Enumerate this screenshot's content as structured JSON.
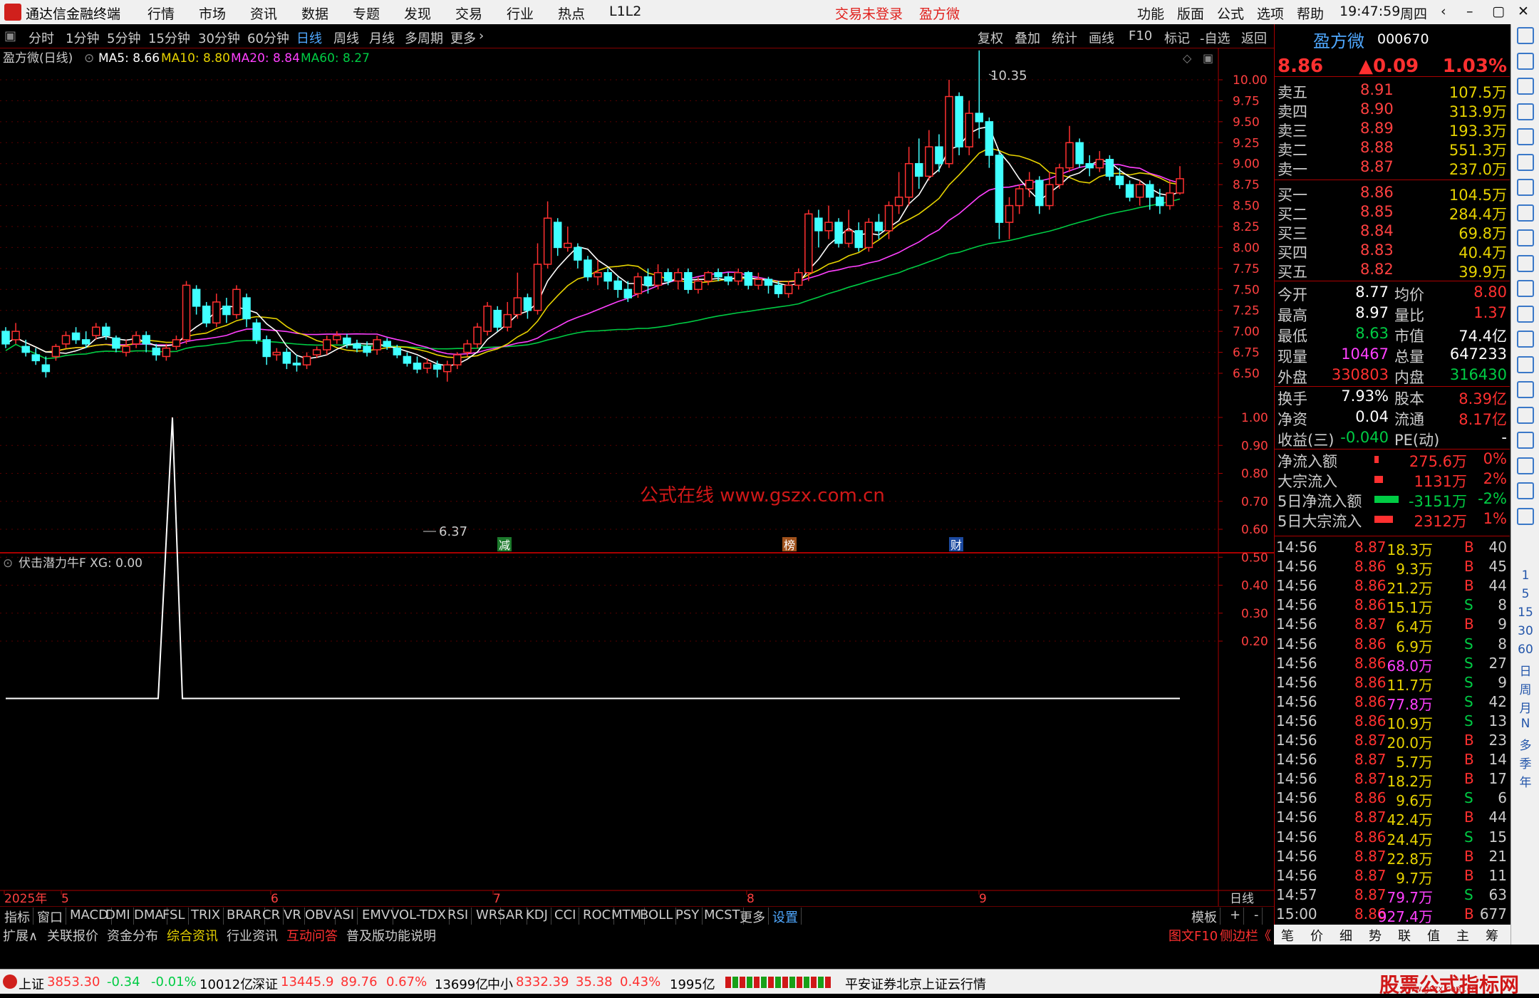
{
  "app": {
    "title": "通达信金融终端",
    "menus": [
      "行情",
      "市场",
      "资讯",
      "数据",
      "专题",
      "发现",
      "交易",
      "行业",
      "热点",
      "L1L2"
    ],
    "status_left": "交易未登录",
    "stock_name_title": "盈方微",
    "right_menus": [
      "功能",
      "版面",
      "公式",
      "选项",
      "帮助"
    ],
    "time": "19:47:59",
    "weekday": "周四"
  },
  "toolbar": {
    "periods": [
      "分时",
      "1分钟",
      "5分钟",
      "15分钟",
      "30分钟",
      "60分钟",
      "日线",
      "周线",
      "月线",
      "多周期",
      "更多"
    ],
    "active": "日线",
    "right": [
      "复权",
      "叠加",
      "统计",
      "画线",
      "F10",
      "标记",
      "-自选",
      "返回"
    ]
  },
  "chart": {
    "header": {
      "name": "盈方微(日线)",
      "ma5": "MA5: 8.66",
      "ma10": "MA10: 8.80",
      "ma20": "MA20: 8.84",
      "ma60": "MA60: 8.27"
    },
    "yticks": [
      "10.00",
      "9.75",
      "9.50",
      "9.25",
      "9.00",
      "8.75",
      "8.50",
      "8.25",
      "8.00",
      "7.75",
      "7.50",
      "7.25",
      "7.00",
      "6.75",
      "6.50"
    ],
    "high_label": "10.35",
    "low_label": "6.37",
    "watermark": "公式在线  www.gszx.com.cn",
    "events": [
      "减",
      "榜",
      "财"
    ]
  },
  "indicator": {
    "header": "伏击潜力牛F  XG: 0.00",
    "yticks": [
      "1.00",
      "0.90",
      "0.80",
      "0.70",
      "0.60",
      "0.50",
      "0.40",
      "0.30",
      "0.20"
    ]
  },
  "xaxis": {
    "labels": [
      "2025年",
      "5",
      "6",
      "7",
      "8",
      "9"
    ],
    "period": "日线"
  },
  "chart_data": {
    "type": "candlestick",
    "title": "盈方微(日线)",
    "ylim": [
      6.3,
      10.4
    ],
    "ma_lines": [
      "MA5",
      "MA10",
      "MA20",
      "MA60"
    ],
    "indicator_series": {
      "name": "XG",
      "ylim": [
        0,
        1.0
      ],
      "spike_value": 1.0,
      "current": 0.0
    }
  },
  "quote": {
    "name": "盈方微",
    "code": "000670",
    "price": "8.86",
    "change": "▲0.09",
    "pct": "1.03%",
    "asks": [
      {
        "l": "卖五",
        "p": "8.91",
        "v": "107.5万"
      },
      {
        "l": "卖四",
        "p": "8.90",
        "v": "313.9万"
      },
      {
        "l": "卖三",
        "p": "8.89",
        "v": "193.3万"
      },
      {
        "l": "卖二",
        "p": "8.88",
        "v": "551.3万"
      },
      {
        "l": "卖一",
        "p": "8.87",
        "v": "237.0万"
      }
    ],
    "bids": [
      {
        "l": "买一",
        "p": "8.86",
        "v": "104.5万"
      },
      {
        "l": "买二",
        "p": "8.85",
        "v": "284.4万"
      },
      {
        "l": "买三",
        "p": "8.84",
        "v": "69.8万"
      },
      {
        "l": "买四",
        "p": "8.83",
        "v": "40.4万"
      },
      {
        "l": "买五",
        "p": "8.82",
        "v": "39.9万"
      }
    ],
    "stats": [
      {
        "l1": "今开",
        "v1": "8.77",
        "l2": "均价",
        "v2": "8.80"
      },
      {
        "l1": "最高",
        "v1": "8.97",
        "l2": "量比",
        "v2": "1.37"
      },
      {
        "l1": "最低",
        "v1": "8.63",
        "l2": "市值",
        "v2": "74.4亿"
      },
      {
        "l1": "现量",
        "v1": "10467",
        "l2": "总量",
        "v2": "647233"
      },
      {
        "l1": "外盘",
        "v1": "330803",
        "l2": "内盘",
        "v2": "316430"
      }
    ],
    "stats2": [
      {
        "l1": "换手",
        "v1": "7.93%",
        "l2": "股本",
        "v2": "8.39亿"
      },
      {
        "l1": "净资",
        "v1": "0.04",
        "l2": "流通",
        "v2": "8.17亿"
      },
      {
        "l1": "收益(三)",
        "v1": "-0.040",
        "l2": "PE(动)",
        "v2": "-"
      }
    ],
    "flows": [
      {
        "l": "净流入额",
        "v": "275.6万",
        "p": "0%"
      },
      {
        "l": "大宗流入",
        "v": "1131万",
        "p": "2%"
      },
      {
        "l": "5日净流入额",
        "v": "-3151万",
        "p": "-2%"
      },
      {
        "l": "5日大宗流入",
        "v": "2312万",
        "p": "1%"
      }
    ],
    "ticks": [
      {
        "t": "14:56",
        "p": "8.87",
        "v": "18.3万",
        "s": "B",
        "n": "40"
      },
      {
        "t": "14:56",
        "p": "8.86",
        "v": "9.3万",
        "s": "B",
        "n": "45"
      },
      {
        "t": "14:56",
        "p": "8.86",
        "v": "21.2万",
        "s": "B",
        "n": "44"
      },
      {
        "t": "14:56",
        "p": "8.86",
        "v": "15.1万",
        "s": "S",
        "n": "8"
      },
      {
        "t": "14:56",
        "p": "8.87",
        "v": "6.4万",
        "s": "B",
        "n": "9"
      },
      {
        "t": "14:56",
        "p": "8.86",
        "v": "6.9万",
        "s": "S",
        "n": "8"
      },
      {
        "t": "14:56",
        "p": "8.86",
        "v": "68.0万",
        "s": "S",
        "n": "27"
      },
      {
        "t": "14:56",
        "p": "8.86",
        "v": "11.7万",
        "s": "S",
        "n": "9"
      },
      {
        "t": "14:56",
        "p": "8.86",
        "v": "77.8万",
        "s": "S",
        "n": "42"
      },
      {
        "t": "14:56",
        "p": "8.86",
        "v": "10.9万",
        "s": "S",
        "n": "13"
      },
      {
        "t": "14:56",
        "p": "8.87",
        "v": "20.0万",
        "s": "B",
        "n": "23"
      },
      {
        "t": "14:56",
        "p": "8.87",
        "v": "5.7万",
        "s": "B",
        "n": "14"
      },
      {
        "t": "14:56",
        "p": "8.87",
        "v": "18.2万",
        "s": "B",
        "n": "17"
      },
      {
        "t": "14:56",
        "p": "8.86",
        "v": "9.6万",
        "s": "S",
        "n": "6"
      },
      {
        "t": "14:56",
        "p": "8.87",
        "v": "42.4万",
        "s": "B",
        "n": "44"
      },
      {
        "t": "14:56",
        "p": "8.86",
        "v": "24.4万",
        "s": "S",
        "n": "15"
      },
      {
        "t": "14:56",
        "p": "8.87",
        "v": "22.8万",
        "s": "B",
        "n": "21"
      },
      {
        "t": "14:56",
        "p": "8.87",
        "v": "9.7万",
        "s": "B",
        "n": "11"
      },
      {
        "t": "14:57",
        "p": "8.87",
        "v": "79.7万",
        "s": "S",
        "n": "63"
      },
      {
        "t": "15:00",
        "p": "8.86",
        "v": "927.4万",
        "s": "B",
        "n": "677"
      }
    ]
  },
  "tabs1": [
    "指标",
    "窗口",
    "MACD",
    "DMI",
    "DMA",
    "FSL",
    "TRIX",
    "BRAR",
    "CR",
    "VR",
    "OBV",
    "ASI",
    "EMV",
    "VOL-TDX",
    "RSI",
    "WR",
    "SAR",
    "KDJ",
    "CCI",
    "ROC",
    "MTM",
    "BOLL",
    "PSY",
    "MCST",
    "更多",
    "设置"
  ],
  "tabs1_right": [
    "模板",
    "+",
    "-"
  ],
  "tabs2": [
    "扩展∧",
    "关联报价",
    "资金分布",
    "综合资讯",
    "行业资讯",
    "互动问答",
    "普及版功能说明"
  ],
  "tabs2_right": [
    "图文F10",
    "侧边栏《"
  ],
  "sidetabs": [
    "笔",
    "价",
    "细",
    "势",
    "联",
    "值",
    "主",
    "筹"
  ],
  "rightbar_text": [
    "1",
    "5",
    "15",
    "30",
    "60",
    "日",
    "周",
    "月",
    "N",
    "多",
    "季",
    "年"
  ],
  "status": {
    "sh": {
      "name": "上证",
      "v": "3853.30",
      "c": "-0.34",
      "p": "-0.01%",
      "a": "10012亿"
    },
    "sz": {
      "name": "深证",
      "v": "13445.9",
      "c": "89.76",
      "p": "0.67%",
      "a": "13699亿"
    },
    "zx": {
      "name": "中小",
      "v": "8332.39",
      "c": "35.38",
      "p": "0.43%",
      "a": "1995亿"
    },
    "server": "平安证券北京上证云行情",
    "brand": "股票公式指标网",
    "brand_url": "www.gszx.com.cn"
  }
}
